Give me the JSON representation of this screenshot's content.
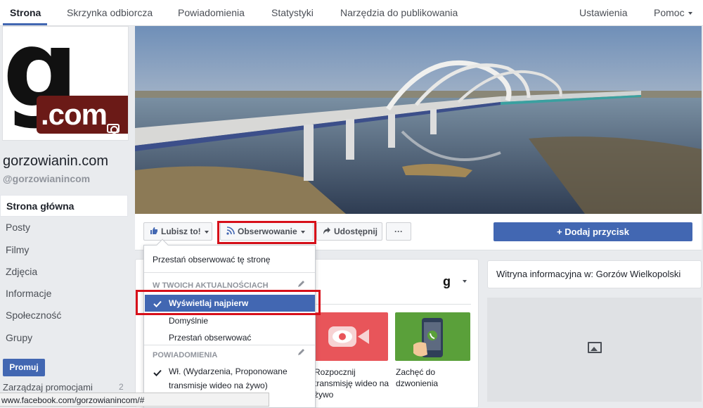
{
  "nav": {
    "tabs": [
      "Strona",
      "Skrzynka odbiorcza",
      "Powiadomienia",
      "Statystyki",
      "Narzędzia do publikowania"
    ],
    "settings": "Ustawienia",
    "help": "Pomoc"
  },
  "page": {
    "logo_letter": "g",
    "logo_domain": ".com",
    "name": "gorzowianin.com",
    "handle": "@gorzowianincom"
  },
  "sidebar": {
    "items": [
      "Strona główna",
      "Posty",
      "Filmy",
      "Zdjęcia",
      "Informacje",
      "Społeczność",
      "Grupy"
    ],
    "promote": "Promuj",
    "manage": "Zarządzaj promocjami",
    "manage_count": "2"
  },
  "actions": {
    "like": "Lubisz to!",
    "follow": "Obserwowanie",
    "share": "Udostępnij",
    "more": "···",
    "add_button": "+ Dodaj przycisk"
  },
  "dropdown": {
    "unfollow_page": "Przestań obserwować tę stronę",
    "feed_header": "W TWOICH AKTUALNOŚCIACH",
    "see_first": "Wyświetlaj najpierw",
    "default": "Domyślnie",
    "unfollow": "Przestań obserwować",
    "notif_header": "POWIADOMIENIA",
    "notif_on_1": "Wł. (Wydarzenia, Proponowane",
    "notif_on_2": "transmisje wideo na żywo)"
  },
  "tiles": [
    {
      "line1": "Rozpocznij",
      "line2": "transmisję wideo na",
      "line3": "żywo"
    },
    {
      "line1": "Zachęć do",
      "line2": "dzwonienia"
    }
  ],
  "right": {
    "info": "Witryna informacyjna w: Gorzów Wielkopolski"
  },
  "status_url": "www.facebook.com/gorzowianincom/#",
  "colors": {
    "accent": "#4267b2",
    "highlight": "#d7101a",
    "video_tile": "#e8555a",
    "call_tile": "#5aa03a"
  }
}
